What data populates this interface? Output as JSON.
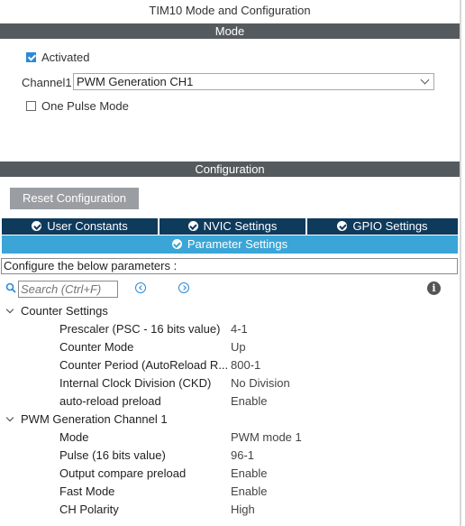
{
  "window": {
    "title": "TIM10 Mode and Configuration"
  },
  "mode_section": {
    "header": "Mode",
    "activated": {
      "label": "Activated",
      "checked": true
    },
    "channel1": {
      "label": "Channel1",
      "value": "PWM Generation CH1"
    },
    "one_pulse": {
      "label": "One Pulse Mode",
      "checked": false
    }
  },
  "config_section": {
    "header": "Configuration",
    "reset_button": "Reset Configuration",
    "tabs": [
      {
        "label": "User Constants"
      },
      {
        "label": "NVIC Settings"
      },
      {
        "label": "GPIO Settings"
      },
      {
        "label": "Parameter Settings"
      }
    ],
    "info_text": "Configure the below parameters :",
    "search": {
      "placeholder": "Search (Ctrl+F)"
    },
    "groups": [
      {
        "name": "Counter Settings",
        "params": [
          {
            "name": "Prescaler (PSC - 16 bits value)",
            "value": "4-1"
          },
          {
            "name": "Counter Mode",
            "value": "Up"
          },
          {
            "name": "Counter Period (AutoReload R...",
            "value": "800-1"
          },
          {
            "name": "Internal Clock Division (CKD)",
            "value": "No Division"
          },
          {
            "name": "auto-reload preload",
            "value": "Enable"
          }
        ]
      },
      {
        "name": "PWM Generation Channel 1",
        "params": [
          {
            "name": "Mode",
            "value": "PWM mode 1"
          },
          {
            "name": "Pulse (16 bits value)",
            "value": "96-1"
          },
          {
            "name": "Output compare preload",
            "value": "Enable"
          },
          {
            "name": "Fast Mode",
            "value": "Enable"
          },
          {
            "name": "CH Polarity",
            "value": "High"
          }
        ]
      }
    ]
  },
  "colors": {
    "section_bar": "#555a5e",
    "tab_dark": "#0e3a5c",
    "tab_active": "#3aa5d6",
    "accent": "#2b8ad8"
  }
}
